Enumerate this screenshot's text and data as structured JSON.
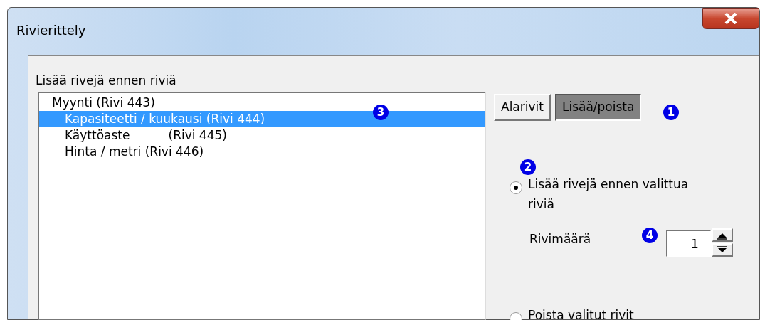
{
  "window": {
    "title": "Rivierittely"
  },
  "list_label": "Lisää rivejä ennen riviä",
  "tree": [
    {
      "label": "Myynti (Rivi 443)",
      "selected": false,
      "children": [
        {
          "label": "Kapasiteetti / kuukausi (Rivi 444)",
          "selected": true
        },
        {
          "label": "Käyttöaste          (Rivi 445)",
          "selected": false
        },
        {
          "label": "Hinta / metri (Rivi 446)",
          "selected": false
        }
      ]
    }
  ],
  "tabs": [
    {
      "label": "Alarivit",
      "selected": false
    },
    {
      "label": "Lisää/poista",
      "selected": true
    }
  ],
  "options": [
    {
      "label": "Lisää rivejä ennen valittua riviä",
      "selected": true
    },
    {
      "label": "Poista valitut rivit",
      "selected": false
    }
  ],
  "count": {
    "label": "Rivimäärä",
    "value": "1"
  },
  "callouts": [
    "3",
    "1",
    "2",
    "4"
  ]
}
